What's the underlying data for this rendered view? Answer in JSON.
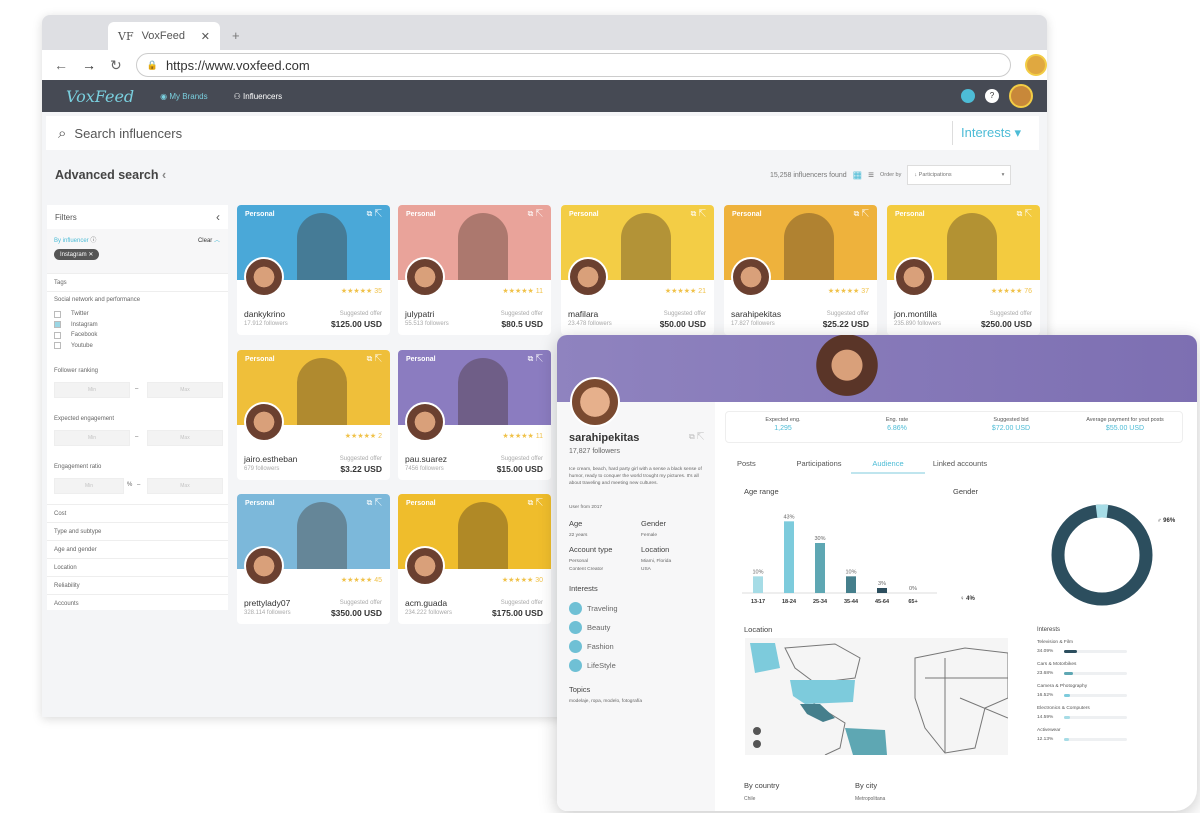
{
  "browser": {
    "tab_title": "VoxFeed",
    "url": "https://www.voxfeed.com"
  },
  "nav": {
    "logo": "VoxFeed",
    "items": [
      "My Brands",
      "Influencers"
    ]
  },
  "search": {
    "placeholder": "Search influencers",
    "interests": "Interests"
  },
  "toolbar": {
    "title": "Advanced search",
    "found": "15,258 influencers found",
    "order_label": "Order by",
    "order_value": "↓ Participations"
  },
  "filters": {
    "title": "Filters",
    "by_influencer": "By influencer",
    "clear": "Clear",
    "chip": "Instagram",
    "tags": "Tags",
    "social_title": "Social network and performance",
    "networks": [
      {
        "label": "Twitter",
        "checked": false
      },
      {
        "label": "Instagram",
        "checked": true
      },
      {
        "label": "Facebook",
        "checked": false
      },
      {
        "label": "Youtube",
        "checked": false
      }
    ],
    "follower_ranking": "Follower ranking",
    "expected_engagement": "Expected engagement",
    "engagement_ratio": "Engagement ratio",
    "min": "Min",
    "max": "Max",
    "percent": "%",
    "dash": "–",
    "sections": [
      "Cost",
      "Type and subtype",
      "Age and gender",
      "Location",
      "Reliability",
      "Accounts"
    ]
  },
  "cards": [
    {
      "tag": "Personal",
      "name": "dankykrino",
      "followers": "17.912 followers",
      "rating": "35",
      "offer_label": "Suggested offer",
      "price": "$125.00 USD",
      "color": "#4aa8d8"
    },
    {
      "tag": "Personal",
      "name": "julypatri",
      "followers": "55.513 followers",
      "rating": "11",
      "offer_label": "Suggested offer",
      "price": "$80.5 USD",
      "color": "#e9a39a"
    },
    {
      "tag": "Personal",
      "name": "mafilara",
      "followers": "23.478 followers",
      "rating": "21",
      "offer_label": "Suggested offer",
      "price": "$50.00 USD",
      "color": "#f3cd45"
    },
    {
      "tag": "Personal",
      "name": "sarahipekitas",
      "followers": "17.827 followers",
      "rating": "37",
      "offer_label": "Suggested offer",
      "price": "$25.22 USD",
      "color": "#eeb23c"
    },
    {
      "tag": "Personal",
      "name": "jon.montilla",
      "followers": "235.890 followers",
      "rating": "76",
      "offer_label": "Suggested offer",
      "price": "$250.00 USD",
      "color": "#f3cb3f"
    },
    {
      "tag": "Personal",
      "name": "jairo.estheban",
      "followers": "679 followers",
      "rating": "2",
      "offer_label": "Suggested offer",
      "price": "$3.22 USD",
      "color": "#efbf3a"
    },
    {
      "tag": "Personal",
      "name": "pau.suarez",
      "followers": "7456 followers",
      "rating": "11",
      "offer_label": "Suggested offer",
      "price": "$15.00 USD",
      "color": "#8b7cc0"
    },
    {
      "tag": "Personal",
      "name": "prettylady07",
      "followers": "328.114 followers",
      "rating": "45",
      "offer_label": "Suggested offer",
      "price": "$350.00 USD",
      "color": "#7cb8da"
    },
    {
      "tag": "Personal",
      "name": "acm.guada",
      "followers": "234.222 followers",
      "rating": "30",
      "offer_label": "Suggested offer",
      "price": "$175.00 USD",
      "color": "#efbd2c"
    }
  ],
  "profile": {
    "name": "sarahipekitas",
    "followers": "17,827 followers",
    "bio": "Ice cream, beach, hard party girl with a sense a black sense of humor, ready to conquer the world trought my pictures. It's all about traveling and meeting new cultures.",
    "since": "User from 2017",
    "age_label": "Age",
    "age": "22 years",
    "gender_label": "Gender",
    "gender": "Female",
    "account_label": "Account type",
    "account": [
      "Personal",
      "Content Creator"
    ],
    "location_label": "Location",
    "location": [
      "Miami, Florida",
      "USA"
    ],
    "interests_label": "Interests",
    "interests": [
      "Traveling",
      "Beauty",
      "Fashion",
      "LifeStyle"
    ],
    "topics_label": "Topics",
    "topics": "modelaje, ropa, modelo, fotografía"
  },
  "stats": [
    {
      "label": "Expected eng.",
      "value": "1,295"
    },
    {
      "label": "Eng. rate",
      "value": "6.86%"
    },
    {
      "label": "Suggested bid",
      "value": "$72.00 USD"
    },
    {
      "label": "Average payment for yout posts",
      "value": "$55.00 USD"
    }
  ],
  "tabs": [
    {
      "label": "Posts",
      "active": false
    },
    {
      "label": "Participations",
      "active": false
    },
    {
      "label": "Audience",
      "active": true
    },
    {
      "label": "Linked accounts",
      "active": false
    }
  ],
  "age_chart": {
    "title": "Age range",
    "categories": [
      "13-17",
      "18-24",
      "25-34",
      "35-44",
      "45-64",
      "65+"
    ],
    "values": [
      10,
      43,
      30,
      10,
      3,
      0
    ],
    "colors": [
      "#a6dce6",
      "#7dcbdc",
      "#5ea7b3",
      "#457f8c",
      "#2c4e5e",
      "#cccccc"
    ]
  },
  "gender_chart": {
    "title": "Gender",
    "male": 96,
    "female": 4,
    "male_label": "96%",
    "female_label": "4%",
    "colors": {
      "male": "#2c4e5e",
      "female": "#a6dce6"
    }
  },
  "location": {
    "title": "Location",
    "by_country": "By country",
    "country": "Chile",
    "by_city": "By city",
    "city": "Metropolitana"
  },
  "audience_interests": {
    "title": "Interests",
    "items": [
      {
        "label": "Television & Film",
        "pct": "34.09%",
        "value": 34.09,
        "color": "#2c4e5e"
      },
      {
        "label": "Cars & Motorbikes",
        "pct": "23.68%",
        "value": 23.68,
        "color": "#5ea7b3"
      },
      {
        "label": "Camera & Photography",
        "pct": "16.52%",
        "value": 16.52,
        "color": "#7dcbdc"
      },
      {
        "label": "Electronics & Computers",
        "pct": "14.59%",
        "value": 14.59,
        "color": "#a6dce6"
      },
      {
        "label": "Activewear",
        "pct": "12.13%",
        "value": 12.13,
        "color": "#a6dce6"
      }
    ]
  }
}
